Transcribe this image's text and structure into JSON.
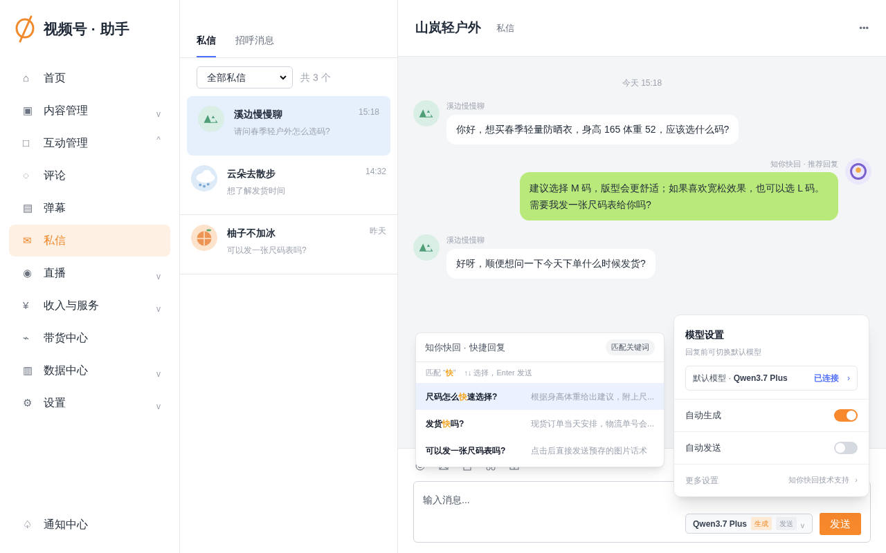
{
  "brand": {
    "title": "视频号 · 助手"
  },
  "nav": [
    {
      "icon": "⌂",
      "label": "首页",
      "selected": false
    },
    {
      "icon": "▣",
      "label": "内容管理",
      "chevron": "v",
      "selected": false
    },
    {
      "icon": "□",
      "label": "互动管理",
      "chevron": "^",
      "selected": false
    },
    {
      "icon": "◌",
      "label": "评论",
      "selected": false
    },
    {
      "icon": "▤",
      "label": "弹幕",
      "selected": false
    },
    {
      "icon": "✉",
      "label": "私信",
      "selected": true
    },
    {
      "icon": "◉",
      "label": "直播",
      "chevron": "v",
      "selected": false
    },
    {
      "icon": "¥",
      "label": "收入与服务",
      "chevron": "v",
      "selected": false
    },
    {
      "icon": "⌁",
      "label": "带货中心",
      "selected": false
    },
    {
      "icon": "▥",
      "label": "数据中心",
      "chevron": "v",
      "selected": false
    },
    {
      "icon": "⚙",
      "label": "设置",
      "chevron": "v",
      "selected": false
    }
  ],
  "nav_footer": {
    "icon": "♤",
    "label": "通知中心"
  },
  "inbox": {
    "tabs": [
      {
        "label": "私信",
        "selected": true
      },
      {
        "label": "招呼消息",
        "selected": false
      }
    ],
    "filter": "全部私信",
    "count": "共 3 个",
    "conversations": [
      {
        "kind": "mountain",
        "name": "溪边慢慢聊",
        "preview": "请问春季轻户外怎么选码?",
        "time": "15:18",
        "selected": true
      },
      {
        "kind": "cloud",
        "name": "云朵去散步",
        "preview": "想了解发货时间",
        "time": "14:32",
        "selected": false
      },
      {
        "kind": "orange",
        "name": "柚子不加冰",
        "preview": "可以发一张尺码表吗?",
        "time": "昨天",
        "selected": false
      }
    ]
  },
  "chat": {
    "title": "山岚轻户外",
    "subtitle": "私信",
    "more": "•••",
    "date": "今天 15:18",
    "messages": [
      {
        "kind": "incoming",
        "sender": "溪边慢慢聊",
        "text": "你好，想买春季轻量防晒衣，身高 165 体重 52，应该选什么码?"
      },
      {
        "kind": "outgoing",
        "sender": "知你快回 · 推荐回复",
        "text": "建议选择 M 码，版型会更舒适；如果喜欢宽松效果，也可以选 L 码。需要我发一张尺码表给你吗?"
      },
      {
        "kind": "incoming",
        "sender": "溪边慢慢聊",
        "text": "好呀，顺便想问一下今天下单什么时候发货?"
      }
    ],
    "composer": {
      "placeholder": "输入消息...",
      "model": "Qwen3.7 Plus",
      "tags": [
        {
          "label": "生成",
          "on": true
        },
        {
          "label": "发送",
          "on": false
        }
      ],
      "chevron": "v",
      "send": "发送"
    }
  },
  "quick_reply": {
    "title": "知你快回 · 快捷回复",
    "badge": "匹配关键词",
    "hint_prefix": "匹配",
    "keyword": "“**快**”",
    "hint": "↑↓ 选择，Enter 发送",
    "items": [
      {
        "question": "尺码怎么**快**速选择?",
        "answer": "根据身高体重给出建议，附上尺...",
        "selected": true
      },
      {
        "question": "发货**快**吗?",
        "answer": "现货订单当天安排，物流单号会...",
        "selected": false
      },
      {
        "question": "可以发一张尺码表吗?",
        "answer": "点击后直接发送预存的图片话术",
        "selected": false
      }
    ]
  },
  "model_settings": {
    "title": "模型设置",
    "subtitle": "回复前可切换默认模型",
    "model_prefix": "默认模型 · ",
    "model": "Qwen3.7 Plus",
    "status": "已连接",
    "chevron": "›",
    "toggles": [
      {
        "label": "自动生成",
        "on": true
      },
      {
        "label": "自动发送",
        "on": false
      }
    ],
    "more": "更多设置",
    "support": "知你快回技术支持",
    "more_chevron": "›"
  }
}
